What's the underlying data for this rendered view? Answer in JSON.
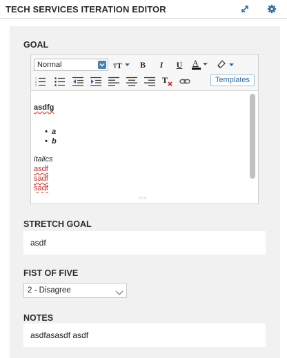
{
  "header": {
    "title": "TECH SERVICES ITERATION EDITOR",
    "expand_icon": "expand-icon",
    "settings_icon": "gear-icon"
  },
  "goal": {
    "label": "GOAL",
    "toolbar": {
      "format_value": "Normal",
      "templates_label": "Templates",
      "icons": [
        "font-size-icon",
        "bold-icon",
        "italic-icon",
        "underline-icon",
        "font-color-icon",
        "highlight-icon",
        "numbered-list-icon",
        "bulleted-list-icon",
        "outdent-icon",
        "indent-icon",
        "align-left-icon",
        "align-center-icon",
        "align-right-icon",
        "clear-format-icon",
        "link-icon"
      ]
    },
    "content": {
      "heading": "asdfg",
      "list_items": [
        "a",
        "b"
      ],
      "italic_line": "italics",
      "red_lines": [
        "asdf",
        "sadf",
        "sadf"
      ]
    }
  },
  "stretch_goal": {
    "label": "STRETCH GOAL",
    "value": "asdf"
  },
  "fist_of_five": {
    "label": "FIST OF FIVE",
    "selected": "2 - Disagree"
  },
  "notes": {
    "label": "NOTES",
    "value": "asdfasasdf asdf"
  },
  "colors": {
    "accent": "#2f6aa3",
    "panel": "#f1f1f1",
    "red_text": "#cc2222"
  }
}
